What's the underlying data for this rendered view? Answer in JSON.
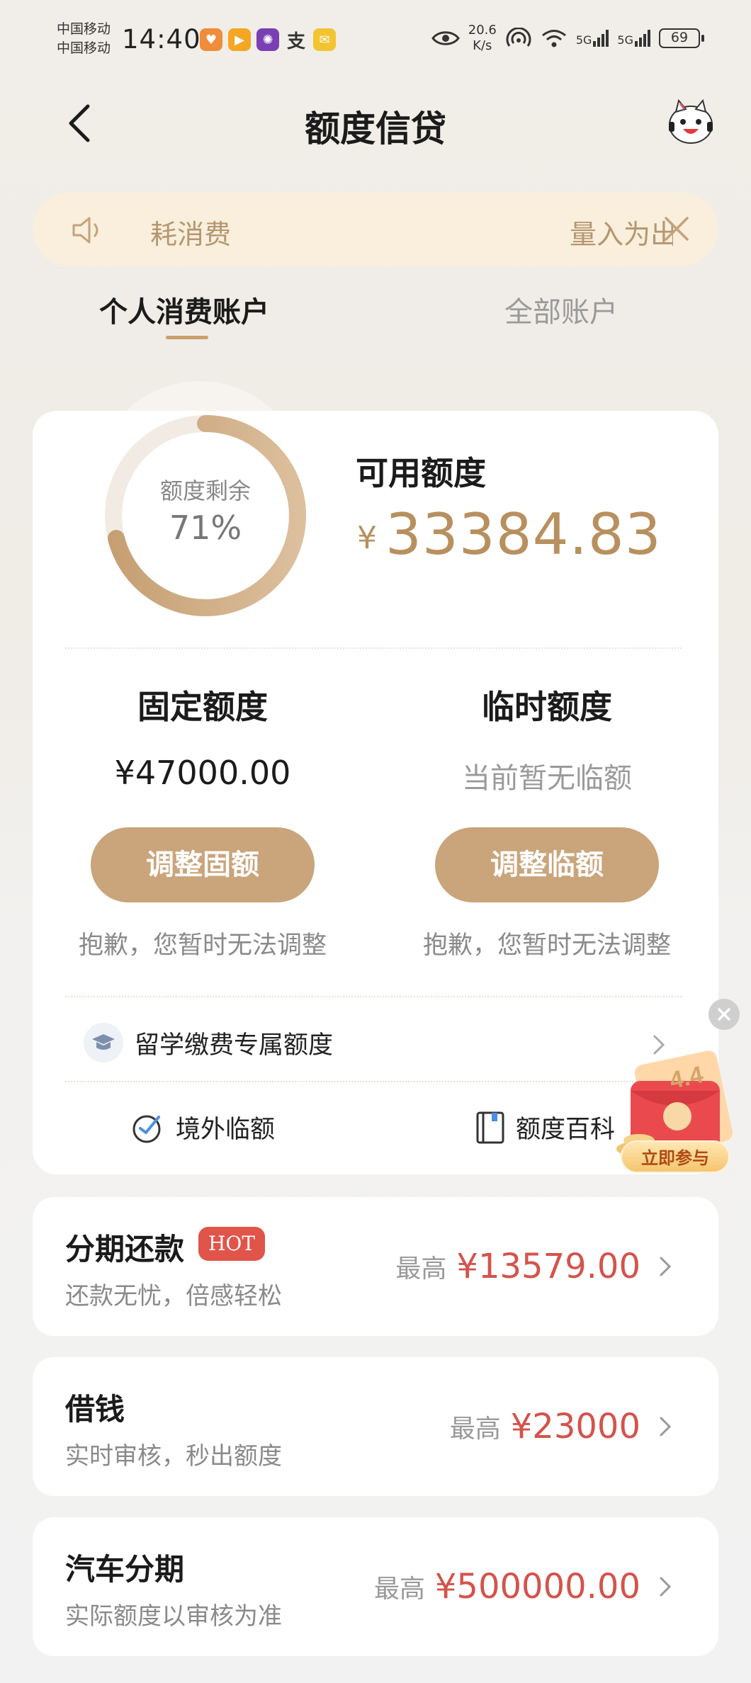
{
  "status_bar": {
    "carrier_1": "中国移动",
    "carrier_2": "中国移动",
    "time": "14:40",
    "net_speed_value": "20.6",
    "net_speed_unit": "K/s",
    "signal_1": "5G",
    "signal_2": "5G",
    "battery": "69"
  },
  "header": {
    "title": "额度信贷"
  },
  "notice": {
    "text_left": "耗消费",
    "text_right": "量入为出"
  },
  "tabs": [
    {
      "label": "个人消费账户",
      "active": true
    },
    {
      "label": "全部账户",
      "active": false
    }
  ],
  "quota": {
    "ring_label": "额度剩余",
    "ring_value": "71%",
    "ring_fraction": 0.71,
    "available_label": "可用额度",
    "currency": "¥",
    "available_amount": "33384.83"
  },
  "fixed": {
    "title": "固定额度",
    "amount": "¥47000.00",
    "button": "调整固额",
    "note": "抱歉，您暂时无法调整"
  },
  "temporary": {
    "title": "临时额度",
    "amount_text": "当前暂无临额",
    "button": "调整临额",
    "note": "抱歉，您暂时无法调整"
  },
  "study_abroad": {
    "label": "留学缴费专属额度"
  },
  "links": {
    "overseas": "境外临额",
    "baike": "额度百科"
  },
  "promo": {
    "badge": "4.4",
    "button": "立即参与"
  },
  "products": [
    {
      "title": "分期还款",
      "badge": "HOT",
      "subtitle": "还款无忧，倍感轻松",
      "prefix": "最高",
      "amount": "¥13579.00"
    },
    {
      "title": "借钱",
      "subtitle": "实时审核，秒出额度",
      "prefix": "最高",
      "amount": "¥23000"
    },
    {
      "title": "汽车分期",
      "subtitle": "实际额度以审核为准",
      "prefix": "最高",
      "amount": "¥500000.00"
    }
  ],
  "colors": {
    "accent_gold": "#caa47a",
    "amount_gold": "#b8905f",
    "price_red": "#d4534b",
    "hot_red": "#e0544a"
  }
}
